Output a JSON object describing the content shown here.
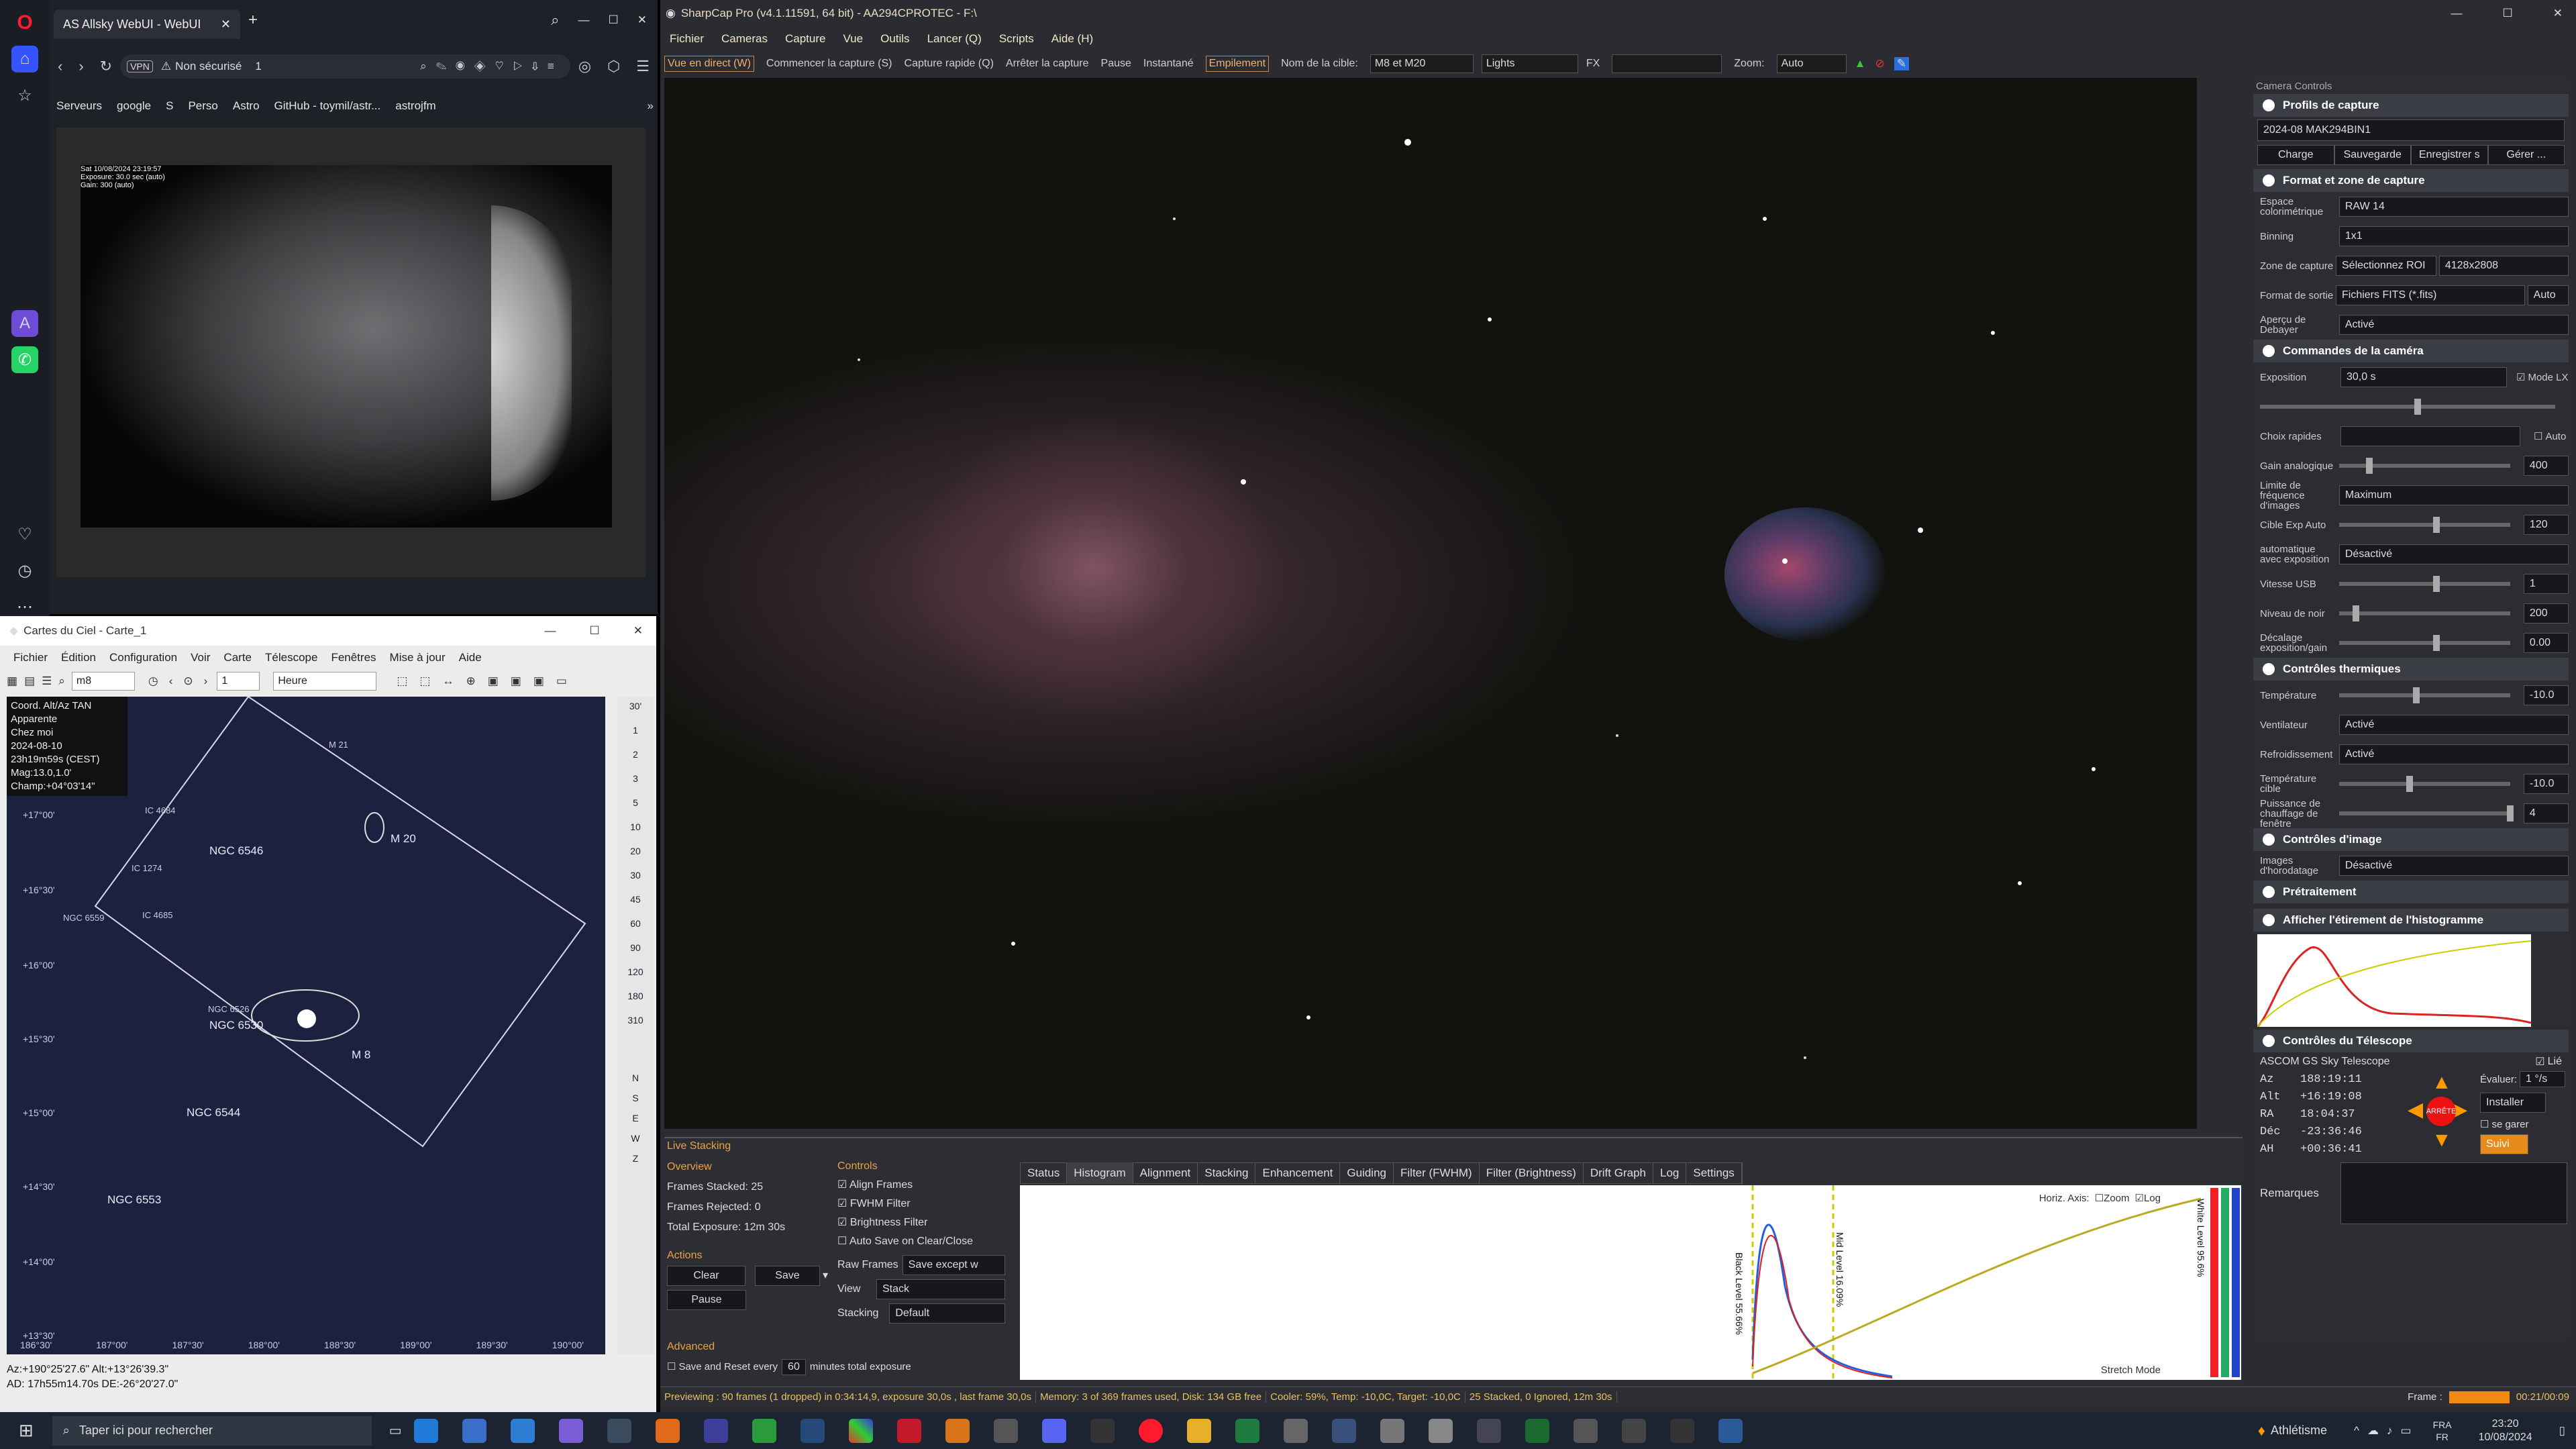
{
  "opera": {
    "logo": "O"
  },
  "browser": {
    "tab_title": "AS Allsky WebUI - WebUI",
    "address": {
      "vpn": "VPN",
      "warning": "Non sécurisé",
      "count": "1"
    },
    "bookmarks": [
      "Serveurs",
      "google",
      "S",
      "Perso",
      "Astro",
      "GitHub - toymil/astr...",
      "astrojfm"
    ],
    "allsky_overlay": [
      "Sat 10/08/2024 23:19:57",
      "Exposure: 30.0 sec (auto)",
      "Gain: 300 (auto)"
    ]
  },
  "sharpcap": {
    "title": "SharpCap Pro (v4.1.11591, 64 bit) - AA294CPROTEC - F:\\",
    "menu": [
      "Fichier",
      "Cameras",
      "Capture",
      "Vue",
      "Outils",
      "Lancer (Q)",
      "Scripts",
      "Aide (H)"
    ],
    "toolbar": {
      "live_view": "Vue en direct (W)",
      "start_capture": "Commencer la capture (S)",
      "quick_capture": "Capture rapide (Q)",
      "stop_capture": "Arrêter la capture",
      "pause": "Pause",
      "snapshot": "Instantané",
      "stacking": "Empilement",
      "target_label": "Nom de la cible:",
      "target_value": "M8 et M20",
      "frame_type": "Lights",
      "fx": "FX",
      "zoom_label": "Zoom:",
      "zoom_value": "Auto"
    },
    "camera_controls": {
      "title": "Camera Controls",
      "profiles": {
        "head": "Profils de capture",
        "value": "2024-08 MAK294BIN1",
        "buttons": [
          "Charge",
          "Sauvegarde",
          "Enregistrer s",
          "Gérer ..."
        ]
      },
      "format": {
        "head": "Format et zone de capture",
        "rows": [
          {
            "label": "Espace colorimétrique",
            "value": "RAW 14"
          },
          {
            "label": "Binning",
            "value": "1x1"
          },
          {
            "label": "Zone de capture",
            "value": "4128x2808",
            "button": "Sélectionnez ROI"
          },
          {
            "label": "Format de sortie",
            "value": "Fichiers FITS (*.fits)",
            "button": "Auto"
          },
          {
            "label": "Aperçu de Debayer",
            "value": "Activé"
          }
        ]
      },
      "camera": {
        "head": "Commandes de la caméra",
        "exposure_label": "Exposition",
        "exposure_value": "30,0 s",
        "lx_mode": "Mode LX",
        "quick_label": "Choix rapides",
        "auto": "Auto",
        "rows": [
          {
            "label": "Gain analogique",
            "value": "400"
          },
          {
            "label": "Limite de fréquence d'images",
            "value": "Maximum"
          },
          {
            "label": "Cible Exp Auto",
            "value": "120"
          },
          {
            "label": "automatique avec exposition",
            "value": "Désactivé"
          },
          {
            "label": "Vitesse USB",
            "value": "1"
          },
          {
            "label": "Niveau de noir",
            "value": "200"
          },
          {
            "label": "Décalage exposition/gain",
            "value": "0.00"
          }
        ]
      },
      "thermal": {
        "head": "Contrôles thermiques",
        "rows": [
          {
            "label": "Température",
            "value": "-10.0"
          },
          {
            "label": "Ventilateur",
            "value": "Activé"
          },
          {
            "label": "Refroidissement",
            "value": "Activé"
          },
          {
            "label": "Température cible",
            "value": "-10.0"
          },
          {
            "label": "Puissance de chauffage de fenêtre",
            "value": "4"
          }
        ]
      },
      "image": {
        "head": "Contrôles d'image",
        "rows": [
          {
            "label": "Images d'horodatage",
            "value": "Désactivé"
          }
        ]
      },
      "preprocess": {
        "head": "Prétraitement"
      },
      "histogram": {
        "head": "Afficher l'étirement de l'histogramme"
      },
      "telescope": {
        "head": "Contrôles du Télescope",
        "name": "ASCOM GS Sky Telescope",
        "linked": "Lié",
        "az": "188:19:11",
        "alt": "+16:19:08",
        "ra": "18:04:37",
        "dec": "-23:36:46",
        "ah": "+00:36:41",
        "eval_label": "Évaluer:",
        "eval_value": "1 °/s",
        "install": "Installer",
        "stop": "ARRÊTE",
        "follow": "Suivi",
        "parked": "se garer",
        "remarks": "Remarques",
        "labels": [
          "Az",
          "Alt",
          "RA",
          "Déc",
          "AH"
        ]
      }
    },
    "live_stacking": {
      "title": "Live Stacking",
      "overview": {
        "head": "Overview",
        "stacked": "Frames Stacked:  25",
        "rejected": "Frames Rejected:  0",
        "total": "Total Exposure:     12m 30s"
      },
      "actions": {
        "head": "Actions",
        "clear": "Clear",
        "save": "Save",
        "pause": "Pause"
      },
      "controls": {
        "head": "Controls",
        "checks": [
          "Align Frames",
          "FWHM Filter",
          "Brightness Filter",
          "Auto Save on Clear/Close"
        ],
        "raw_label": "Raw Frames",
        "raw_value": "Save except w",
        "view_label": "View",
        "view_value": "Stack",
        "stacking_label": "Stacking",
        "stacking_value": "Default"
      },
      "advanced": {
        "head": "Advanced",
        "save_reset": "Save and Reset every",
        "minutes": "60",
        "suffix": "minutes total exposure"
      },
      "tabs": [
        "Status",
        "Histogram",
        "Alignment",
        "Stacking",
        "Enhancement",
        "Guiding",
        "Filter (FWHM)",
        "Filter (Brightness)",
        "Drift Graph",
        "Log",
        "Settings"
      ],
      "hist": {
        "horiz": "Horiz. Axis:",
        "zoom": "Zoom",
        "log": "Log",
        "black": "Black Level 55.66%",
        "mid": "Mid Level 16.09%",
        "white": "White Level 95.6%",
        "stretch": "Stretch Mode"
      }
    },
    "status": {
      "preview": "Previewing : 90 frames (1 dropped) in 0:34:14,9, exposure 30,0s , last frame 30,0s",
      "memory": "Memory: 3 of 369 frames used, Disk: 134 GB free",
      "cooler": "Cooler: 59%, Temp: -10,0C, Target: -10,0C",
      "stacked": "25 Stacked, 0 Ignored, 12m 30s",
      "frame_label": "Frame :",
      "timer": "00:21/00:09"
    }
  },
  "cdc": {
    "title": "Cartes du Ciel - Carte_1",
    "menu": [
      "Fichier",
      "Édition",
      "Configuration",
      "Voir",
      "Carte",
      "Télescope",
      "Fenêtres",
      "Mise à jour",
      "Aide"
    ],
    "search": "m8",
    "step": "1",
    "unit": "Heure",
    "info": [
      "Coord. Alt/Az TAN",
      "Apparente",
      "Chez moi",
      "2024-08-10",
      "23h19m59s (CEST)",
      "Mag:13.0,1.0'",
      "Champ:+04°03'14\""
    ],
    "objects": [
      {
        "name": "M 20",
        "cls": "big"
      },
      {
        "name": "NGC 6546",
        "cls": "big"
      },
      {
        "name": "NGC 6530",
        "cls": "big"
      },
      {
        "name": "M 8",
        "cls": "big"
      },
      {
        "name": "NGC 6544",
        "cls": "big"
      },
      {
        "name": "NGC 6553",
        "cls": "big"
      },
      {
        "name": "M 21",
        "cls": "small"
      },
      {
        "name": "IC 4684",
        "cls": "small"
      },
      {
        "name": "IC 1274",
        "cls": "small"
      },
      {
        "name": "IC 4685",
        "cls": "small"
      },
      {
        "name": "NGC 6559",
        "cls": "small"
      },
      {
        "name": "NGC 6526",
        "cls": "small"
      }
    ],
    "dec_ticks": [
      "+17°00'",
      "+16°30'",
      "+16°00'",
      "+15°30'",
      "+15°00'",
      "+14°30'",
      "+14°00'",
      "+13°30'"
    ],
    "ra_ticks": [
      "186°30'",
      "187°00'",
      "187°30'",
      "188°00'",
      "188°30'",
      "189°00'",
      "189°30'",
      "190°00'"
    ],
    "zoom_scale": [
      "30'",
      "1",
      "2",
      "3",
      "5",
      "10",
      "20",
      "30",
      "45",
      "60",
      "90",
      "120",
      "180",
      "310"
    ],
    "compass": [
      "N",
      "S",
      "E",
      "W",
      "Z"
    ],
    "status1": "Az:+190°25'27.6\" Alt:+13°26'39.3\"",
    "status2": "AD: 17h55m14.70s DE:-26°20'27.0\""
  },
  "taskbar": {
    "search": "Taper ici pour rechercher",
    "athlete": "Athlétisme",
    "lang1": "FRA",
    "lang2": "FR",
    "time": "23:20",
    "date": "10/08/2024"
  }
}
